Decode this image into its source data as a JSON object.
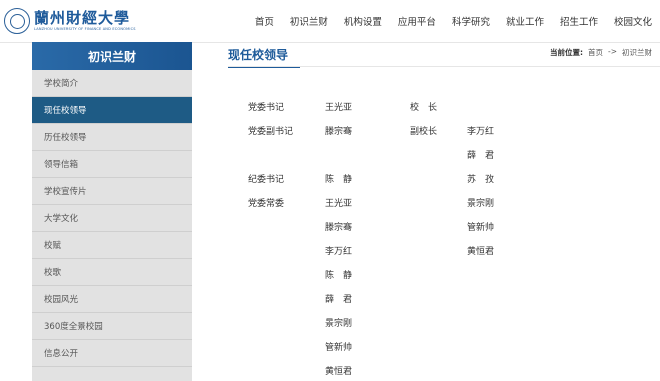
{
  "header": {
    "logo_cn": "蘭州財經大學",
    "logo_en": "LANZHOU UNIVERSITY OF FINANCE AND ECONOMICS",
    "nav": [
      "首页",
      "初识兰财",
      "机构设置",
      "应用平台",
      "科学研究",
      "就业工作",
      "招生工作",
      "校园文化"
    ]
  },
  "sidebar": {
    "title": "初识兰财",
    "items": [
      "学校简介",
      "现任校领导",
      "历任校领导",
      "领导信箱",
      "学校宣传片",
      "大学文化",
      "校赋",
      "校歌",
      "校园风光",
      "360度全景校园",
      "信息公开"
    ],
    "active_index": 1
  },
  "main": {
    "title": "现任校领导",
    "breadcrumb": {
      "label": "当前位置:",
      "path": [
        "首页",
        "->",
        "初识兰财"
      ]
    }
  },
  "leaders": {
    "party_secretary_label": "党委书记",
    "party_secretary": "王光亚",
    "deputy_party_secretary_label": "党委副书记",
    "deputy_party_secretary": "滕宗骞",
    "president_label": "校　长",
    "vice_president_label": "副校长",
    "vice_presidents": [
      "李万红",
      "薛　君",
      "苏　孜",
      "景宗刚",
      "管新帅",
      "黄恒君"
    ],
    "discipline_secretary_label": "纪委书记",
    "discipline_secretary": "陈　静",
    "standing_committee_label": "党委常委",
    "standing_committee": [
      "王光亚",
      "滕宗骞",
      "李万红",
      "陈　静",
      "薛　君",
      "景宗刚",
      "管新帅",
      "黄恒君"
    ]
  }
}
